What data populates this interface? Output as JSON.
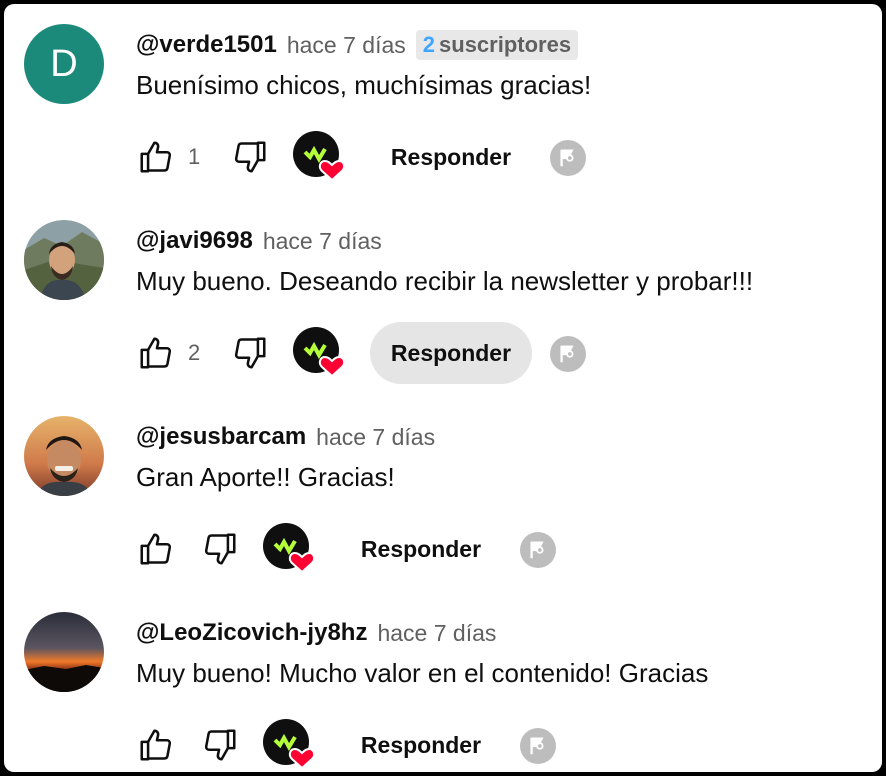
{
  "comments": [
    {
      "handle": "@verde1501",
      "time": "hace 7 días",
      "badge_count": "2",
      "badge_label": "suscriptores",
      "avatar_letter": "D",
      "avatar_color": "#1b8a7b",
      "text": "Buenísimo chicos, muchísimas gracias!",
      "likes": "1",
      "reply_label": "Responder"
    },
    {
      "handle": "@javi9698",
      "time": "hace 7 días",
      "avatar": "photo-man-beard-outdoors",
      "text": "Muy bueno. Deseando recibir la newsletter y probar!!!",
      "likes": "2",
      "reply_label": "Responder"
    },
    {
      "handle": "@jesusbarcam",
      "time": "hace 7 días",
      "avatar": "photo-man-smiling-sunset",
      "text": "Gran Aporte!! Gracias!",
      "likes": "",
      "reply_label": "Responder"
    },
    {
      "handle": "@LeoZicovich-jy8hz",
      "time": "hace 7 días",
      "avatar": "photo-sunset-horizon",
      "text": "Muy bueno! Mucho valor en el contenido! Gracias",
      "likes": "",
      "reply_label": "Responder"
    }
  ],
  "icons": {
    "like": "thumbs-up-icon",
    "dislike": "thumbs-down-icon",
    "creator_heart": "creator-heart-icon",
    "flag": "flag-icon"
  },
  "colors": {
    "heart": "#ff0033",
    "creator_logo_accent": "#b4ff39",
    "badge_number": "#3ea6ff"
  }
}
